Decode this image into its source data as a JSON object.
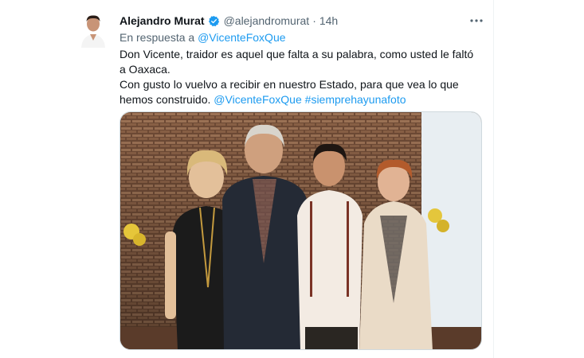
{
  "tweet": {
    "author_name": "Alejandro Murat",
    "author_handle": "@alejandromurat",
    "separator": "·",
    "time": "14h",
    "reply_prefix": "En respuesta a",
    "reply_to": "@VicenteFoxQue",
    "text_line1": "Don Vicente, traidor es aquel que falta a su palabra, como usted le faltó a Oaxaca.",
    "text_line2": "Con gusto lo vuelvo a recibir en nuestro Estado, para que vea lo que hemos construido.",
    "mention": "@VicenteFoxQue",
    "hashtag": "#siemprehayunafoto"
  },
  "icons": {
    "verified": "verified-badge-icon",
    "more": "more-options-icon"
  },
  "colors": {
    "accent": "#1d9bf0",
    "text": "#0f1419",
    "secondary": "#536471",
    "border": "#cfd9de"
  }
}
